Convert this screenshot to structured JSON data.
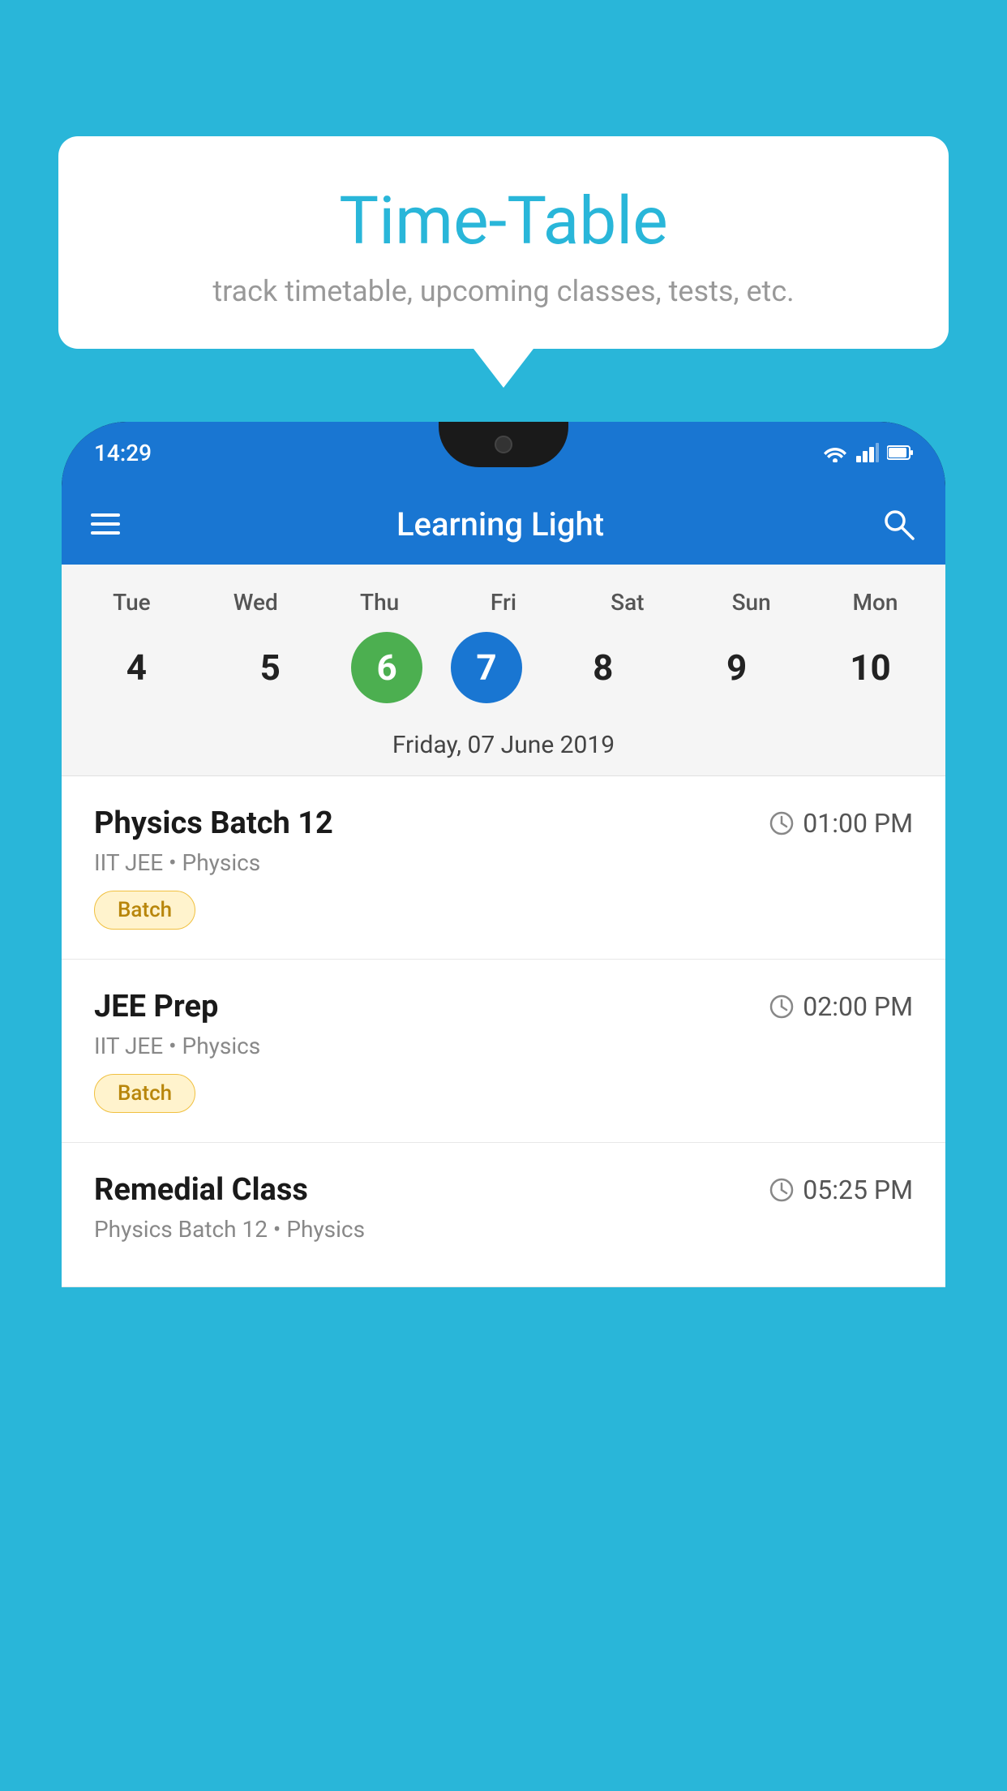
{
  "background_color": "#29b6d9",
  "tooltip": {
    "title": "Time-Table",
    "subtitle": "track timetable, upcoming classes, tests, etc."
  },
  "phone": {
    "status_bar": {
      "time": "14:29",
      "icons": [
        "wifi",
        "signal",
        "battery"
      ]
    },
    "app_bar": {
      "title": "Learning Light",
      "menu_icon": "hamburger",
      "search_icon": "search"
    },
    "calendar": {
      "days": [
        {
          "label": "Tue",
          "number": "4"
        },
        {
          "label": "Wed",
          "number": "5"
        },
        {
          "label": "Thu",
          "number": "6",
          "state": "today"
        },
        {
          "label": "Fri",
          "number": "7",
          "state": "selected"
        },
        {
          "label": "Sat",
          "number": "8"
        },
        {
          "label": "Sun",
          "number": "9"
        },
        {
          "label": "Mon",
          "number": "10"
        }
      ],
      "selected_date_label": "Friday, 07 June 2019"
    },
    "classes": [
      {
        "name": "Physics Batch 12",
        "time": "01:00 PM",
        "subtitle": "IIT JEE • Physics",
        "tag": "Batch"
      },
      {
        "name": "JEE Prep",
        "time": "02:00 PM",
        "subtitle": "IIT JEE • Physics",
        "tag": "Batch"
      },
      {
        "name": "Remedial Class",
        "time": "05:25 PM",
        "subtitle": "Physics Batch 12 • Physics",
        "tag": null
      }
    ]
  }
}
